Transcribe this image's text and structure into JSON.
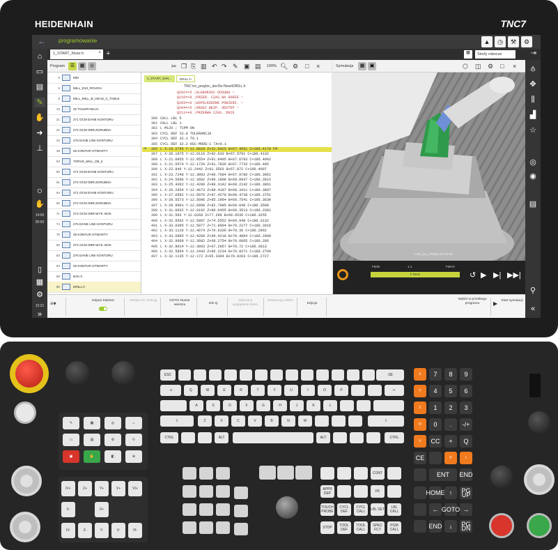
{
  "brand": {
    "left": "HEIDENHAIN",
    "right": "TNC7"
  },
  "top_bar": {
    "mode": "programowanie"
  },
  "file_tab": {
    "name": "1_START_Nose.h"
  },
  "layout_select": "Strefy robocze",
  "program_panel": {
    "title": "Program",
    "zoom": "100%"
  },
  "tree_rows": [
    {
      "num": "0",
      "label": "MM"
    },
    {
      "num": "5",
      "label": "MILL_D10_ROUGH"
    },
    {
      "num": "6",
      "label": "MILL_MILL_B_HEAD_C_TABLE"
    },
    {
      "num": "13",
      "label": "32 TOLERANCJA"
    },
    {
      "num": "21",
      "label": "271 OCM DANE KONTURU"
    },
    {
      "num": "22",
      "label": "272 OCM OBR.ZGRUBNA"
    },
    {
      "num": "34",
      "label": "276 DANE LINII KONTURU"
    },
    {
      "num": "39",
      "label": "25 KONTUR OTWARTY"
    },
    {
      "num": "53",
      "label": "TORUS_MILL_D8_2"
    },
    {
      "num": "60",
      "label": "271 OCM DANE KONTURU"
    },
    {
      "num": "61",
      "label": "272 OCM OBR.ZGRUBNA"
    },
    {
      "num": "64",
      "label": "271 OCM DANE KONTURU"
    },
    {
      "num": "65",
      "label": "272 OCM OBR.ZGRUBNA"
    },
    {
      "num": "71",
      "label": "274 OCM OBR.WYK. BOK"
    },
    {
      "num": "74",
      "label": "276 DANE LINII KONTURU"
    },
    {
      "num": "75",
      "label": "25 KONTUR OTWARTY"
    },
    {
      "num": "80",
      "label": "274 OCM OBR.WYK. BOK"
    },
    {
      "num": "83",
      "label": "276 DANE LINII KONTURU"
    },
    {
      "num": "84",
      "label": "25 KONTUR OTWARTY"
    },
    {
      "num": "89",
      "label": "BAK.h"
    },
    {
      "num": "90",
      "label": "DRILL.h"
    }
  ],
  "editor": {
    "crumbs": [
      "1_START_SeN…",
      "DRILL.h"
    ],
    "path": "TNC:\\nc_prog\\nc_doc\\5x-Nose\\DRILL.h",
    "lines": [
      {
        "ln": "",
        "text": "Q202=+5   ;GLEBOKOSC DOSUWU ~",
        "q": true
      },
      {
        "ln": "",
        "text": "Q210=+0   ;PRZER. CZAS.NA GORZE ~",
        "q": true
      },
      {
        "ln": "",
        "text": "Q203=+0   ;WSPOLRZEDNE POWIERZ. ~",
        "q": true
      },
      {
        "ln": "",
        "text": "Q204=+5   ;DRUGI BEZP. ODSTEP ~",
        "q": true
      },
      {
        "ln": "",
        "text": "Q211=+0   ;PRZERWA CZAS. DNIE",
        "q": true
      },
      {
        "ln": "380",
        "text": "CALL LBL 5"
      },
      {
        "ln": "381",
        "text": "CALL LBL 1"
      },
      {
        "ln": "382",
        "text": "L M126 ; TCPM ON"
      },
      {
        "ln": "383",
        "text": "CYCL DEF 32.0 TOLERANCJA"
      },
      {
        "ln": "384",
        "text": "CYCL DEF 32.1 T0.1"
      },
      {
        "ln": "385",
        "text": "CYCL DEF 32.2 HSC-MODE:1 TA+0.1"
      },
      {
        "ln": "386",
        "text": "L X-19.2766 Y-11.0019 Z+31.0425 B+67.4551 C+186.4179 FM",
        "active": true
      },
      {
        "ln": "387",
        "text": "L X-20.1675 Y-12.6116 Z+92.033 B+67.5791 C+186.4132"
      },
      {
        "ln": "388",
        "text": "L X-21.0955 Y-12.0554 Z+91.9495 B+67.6793 C+186.4092"
      },
      {
        "ln": "389",
        "text": "L X-21.5574 Y-12.1729 Z+91.7836 B+67.7733 C+186.405"
      },
      {
        "ln": "390",
        "text": "L X-22.846 Y-12.2442 Z+91.3563 B+67.872 C+186.4007"
      },
      {
        "ln": "391",
        "text": "L X-23.7248 Y-12.3093 Z+90.7684 B+67.9786 C+186.3961"
      },
      {
        "ln": "392",
        "text": "L X-24.5696 Y-12.3682 Z+90.1008 B+68.0937 C+186.3913"
      },
      {
        "ln": "393",
        "text": "L X-25.4362 Y-12.4209 Z+89.3142 B+68.2142 C+186.3861"
      },
      {
        "ln": "394",
        "text": "L X-26.2654 Y-12.4673 Z+88.4197 B+68.3411 C+186.3807"
      },
      {
        "ln": "395",
        "text": "L X-27.0582 Y-12.5076 Z+87.4278 B+68.4738 C+186.3751"
      },
      {
        "ln": "396",
        "text": "L X-28.5573 Y-12.5696 Z+85.1964 B+68.7541 C+186.3630"
      },
      {
        "ln": "397",
        "text": "L X-29.9001 Y-12.6098 Z+82.7085 B+69.049 C+186.3508"
      },
      {
        "ln": "398",
        "text": "L X-31.0932 Y-12.6192 Z+80.0455 B+69.3513 C+186.3381"
      },
      {
        "ln": "399",
        "text": "L X-31.593 Y-12.6268 Z+77.299 B+69.6535 C+186.3255"
      },
      {
        "ln": "400",
        "text": "L X-32.8562 Y-12.5897 Z+74.5552 B+69.948 C+186.3132"
      },
      {
        "ln": "401",
        "text": "L X-33.0395 Y-12.5077 Z+71.9004 B+70.2277 C+186.3016"
      },
      {
        "ln": "402",
        "text": "L X-33.1116 Y-12.4674 Z+70.6336 B+70.36 C+186.2962"
      },
      {
        "ln": "403",
        "text": "L X-33.0985 Y-12.4209 Z+69.4218 B+70.4864 C+186.2909"
      },
      {
        "ln": "404",
        "text": "L X-32.9669 Y-12.3682 Z+68.2754 B+70.6065 C+186.286"
      },
      {
        "ln": "405",
        "text": "L X-32.8014 Y-12.3093 Z+67.2057 B+70.72 C+186.2813"
      },
      {
        "ln": "406",
        "text": "L X-32.5854 Y-12.2443 Z+66.2234 B+70.8271 C+186.2769"
      },
      {
        "ln": "407",
        "text": "L X-32.1135 Y-12.172 Z+65.3394 B+70.9283 C+186.2727"
      }
    ]
  },
  "sim_panel": {
    "title": "Symulacja",
    "status": "1  M3_D4_FR6MA 00:10:18",
    "fmin": "FMIN",
    "fmax": "FMAX",
    "mid": "1:1",
    "speed": "F MAX"
  },
  "softkeys": {
    "edytor": "Edytor Klartext",
    "wstaw": "Wstaw NC funkcję",
    "goto": "GOTO Numer wiersza",
    "info": "Info Q",
    "odwrotny": "Odwrotny wyglądanie bloku",
    "sekwencja": "Sekwencja OMD+",
    "edycja": "Edycja",
    "wybor": "Wybór w przebiegu programu",
    "start": "Start symulacji"
  },
  "rail": {
    "time1": "14:06",
    "time2": "00:00",
    "time3": "10:21"
  },
  "keyboard": {
    "row1": [
      "Q",
      "W",
      "E",
      "R",
      "T",
      "Y",
      "U",
      "I",
      "O",
      "P"
    ],
    "row2": [
      "A",
      "S",
      "D",
      "F",
      "G",
      "H",
      "J",
      "K",
      "L"
    ],
    "row3": [
      "Z",
      "X",
      "C",
      "V",
      "B",
      "N",
      "M"
    ],
    "esc": "ESC",
    "ctrl_l": "CTRL",
    "alt": "ALT",
    "alt_r": "ALT",
    "ctrl_r": "CTRL"
  },
  "numpad": {
    "rows": [
      [
        "X",
        "7",
        "8",
        "9"
      ],
      [
        "Y",
        "4",
        "5",
        "6"
      ],
      [
        "Z",
        "1",
        "2",
        "3"
      ],
      [
        "IV",
        "0",
        ".",
        "-/+"
      ],
      [
        "V",
        "CC",
        "+",
        "Q"
      ]
    ],
    "ce": "CE",
    "ent": "ENT",
    "end": "END"
  },
  "nc_keys": {
    "row1": [
      "TOUCH PROBE",
      "CYCL DEF",
      "CYCL CALL",
      "LBL SET",
      "LBL CALL"
    ],
    "row2": [
      "STOP",
      "TOOL DEF",
      "TOOL CALL",
      "SPEC FCT",
      "PGM CALL"
    ],
    "cont": "CONT",
    "appr": "APPR DEP",
    "fk": "FK"
  },
  "misc_keys": {
    "home": "HOME",
    "pgup": "PG UP",
    "pgdn": "PG DN",
    "goto": "GOTO",
    "end": "END"
  },
  "axis_keys": [
    "IV+",
    "Z+",
    "Y+",
    "V+",
    "VI+",
    "X-",
    "X+",
    "IV-",
    "Z-",
    "Y-",
    "V-",
    "VI-"
  ]
}
